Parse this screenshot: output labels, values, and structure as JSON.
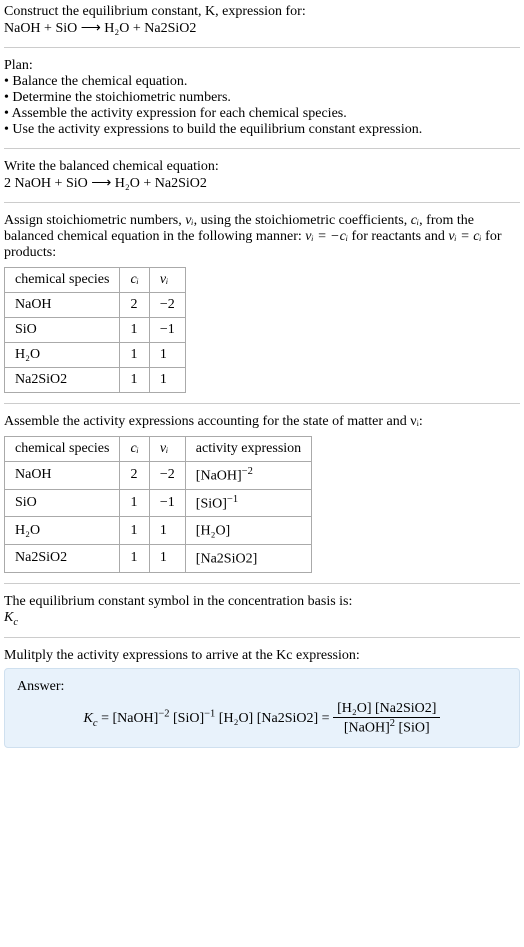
{
  "intro": {
    "line1": "Construct the equilibrium constant, K, expression for:",
    "equation": "NaOH + SiO ⟶ H₂O + Na2SiO2"
  },
  "plan": {
    "heading": "Plan:",
    "b1": "• Balance the chemical equation.",
    "b2": "• Determine the stoichiometric numbers.",
    "b3": "• Assemble the activity expression for each chemical species.",
    "b4": "• Use the activity expressions to build the equilibrium constant expression."
  },
  "balanced": {
    "heading": "Write the balanced chemical equation:",
    "equation": "2 NaOH + SiO ⟶ H₂O + Na2SiO2"
  },
  "assign": {
    "text_a": "Assign stoichiometric numbers, ",
    "text_b": ", using the stoichiometric coefficients, ",
    "text_c": ", from the balanced chemical equation in the following manner: ",
    "text_d": " for reactants and ",
    "text_e": " for products:",
    "nu": "νᵢ",
    "ci": "cᵢ",
    "eq1": "νᵢ = −cᵢ",
    "eq2": "νᵢ = cᵢ",
    "table": {
      "h0": "chemical species",
      "h1": "cᵢ",
      "h2": "νᵢ",
      "rows": [
        {
          "s": "NaOH",
          "c": "2",
          "n": "−2"
        },
        {
          "s": "SiO",
          "c": "1",
          "n": "−1"
        },
        {
          "s": "H₂O",
          "c": "1",
          "n": "1"
        },
        {
          "s": "Na2SiO2",
          "c": "1",
          "n": "1"
        }
      ]
    }
  },
  "assemble": {
    "heading": "Assemble the activity expressions accounting for the state of matter and νᵢ:",
    "table": {
      "h0": "chemical species",
      "h1": "cᵢ",
      "h2": "νᵢ",
      "h3": "activity expression",
      "rows": [
        {
          "s": "NaOH",
          "c": "2",
          "n": "−2",
          "a_base": "[NaOH]",
          "a_exp": "−2"
        },
        {
          "s": "SiO",
          "c": "1",
          "n": "−1",
          "a_base": "[SiO]",
          "a_exp": "−1"
        },
        {
          "s": "H₂O",
          "c": "1",
          "n": "1",
          "a_base": "[H₂O]",
          "a_exp": ""
        },
        {
          "s": "Na2SiO2",
          "c": "1",
          "n": "1",
          "a_base": "[Na2SiO2]",
          "a_exp": ""
        }
      ]
    }
  },
  "symbol": {
    "heading": "The equilibrium constant symbol in the concentration basis is:",
    "kc_k": "K",
    "kc_c": "c"
  },
  "multiply": {
    "heading": "Mulitply the activity expressions to arrive at the Kc expression:",
    "answer_label": "Answer:",
    "lhs_k": "K",
    "lhs_c": "c",
    "t1": " = [NaOH]",
    "e1": "−2",
    "t2": " [SiO]",
    "e2": "−1",
    "t3": " [H₂O] [Na2SiO2] = ",
    "num": "[H₂O] [Na2SiO2]",
    "den_a": "[NaOH]",
    "den_exp": "2",
    "den_b": " [SiO]"
  }
}
